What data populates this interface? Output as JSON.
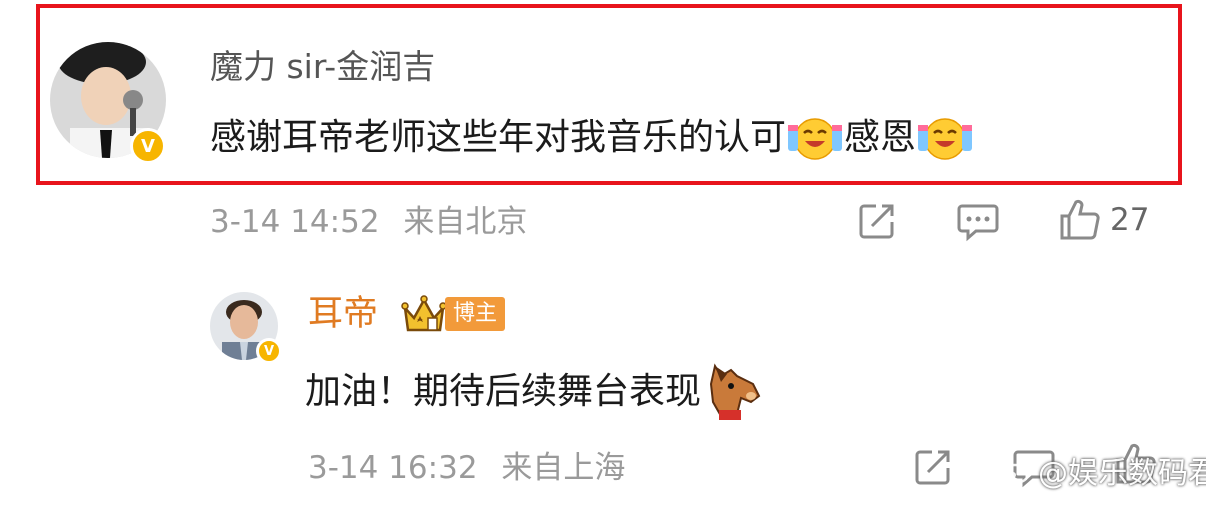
{
  "comment": {
    "username": "魔力 sir-金润吉",
    "text": "感谢耳帝老师这些年对我音乐的认可",
    "text_suffix": "感恩",
    "date": "3-14 14:52",
    "location": "来自北京",
    "likes": "27"
  },
  "reply": {
    "username": "耳帝",
    "role_badge": "博主",
    "text": "加油！期待后续舞台表现",
    "date": "3-14 16:32",
    "location": "来自上海"
  },
  "watermark": "@娱乐数码君",
  "verified_mark": "V",
  "colors": {
    "highlight": "#e8141c",
    "author_name": "#e07b22",
    "verified": "#f7b500",
    "meta": "#9a9a9a"
  },
  "icons": [
    "share-icon",
    "comment-icon",
    "like-icon",
    "crying-laugh-emoji",
    "horse-emoji",
    "crown-badge-icon",
    "weibo-logo-icon"
  ]
}
